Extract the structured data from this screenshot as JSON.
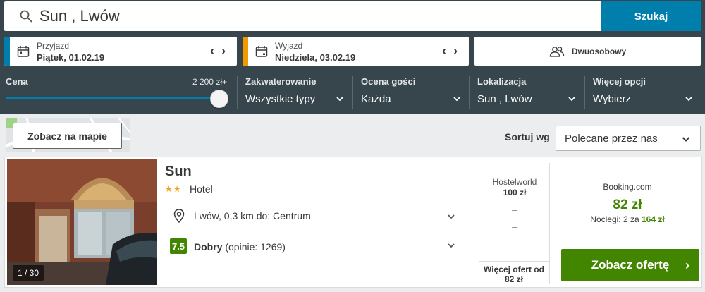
{
  "search": {
    "query": "Sun , Lwów",
    "button_label": "Szukaj"
  },
  "checkin": {
    "label": "Przyjazd",
    "value": "Piątek, 01.02.19",
    "accent_color": "#007fad"
  },
  "checkout": {
    "label": "Wyjazd",
    "value": "Niedziela, 03.02.19",
    "accent_color": "#f09a00"
  },
  "room": {
    "label": "Dwuosobowy"
  },
  "filters": {
    "price": {
      "title": "Cena",
      "max_label": "2 200 zł+",
      "slider_fraction": 1.0
    },
    "accommodation": {
      "title": "Zakwaterowanie",
      "value": "Wszystkie typy"
    },
    "rating": {
      "title": "Ocena gości",
      "value": "Każda"
    },
    "location": {
      "title": "Lokalizacja",
      "value": "Sun , Lwów"
    },
    "more": {
      "title": "Więcej opcji",
      "value": "Wybierz"
    }
  },
  "map": {
    "button_label": "Zobacz na mapie"
  },
  "sort": {
    "label": "Sortuj wg",
    "value": "Polecane przez nas"
  },
  "result": {
    "name": "Sun",
    "stars": "★★",
    "type": "Hotel",
    "photo_counter": "1 / 30",
    "location": "Lwów, 0,3 km do: Centrum",
    "rating_score": "7.5",
    "rating_word": "Dobry",
    "rating_reviews": "(opinie: 1269)",
    "alt_offer": {
      "site": "Hostelworld",
      "price": "100 zł",
      "dash1": "–",
      "dash2": "–"
    },
    "more_offers": {
      "line1": "Więcej ofert od",
      "line2": "82 zł"
    },
    "best_offer": {
      "site": "Booking.com",
      "price": "82 zł",
      "nights_prefix": "Noclegi: 2 za",
      "nights_total": "164 zł",
      "cta_label": "Zobacz ofertę",
      "cta_arrow": "›"
    }
  },
  "colors": {
    "header_bg": "#37454d",
    "accent_blue": "#007fad",
    "accent_green": "#428500"
  }
}
